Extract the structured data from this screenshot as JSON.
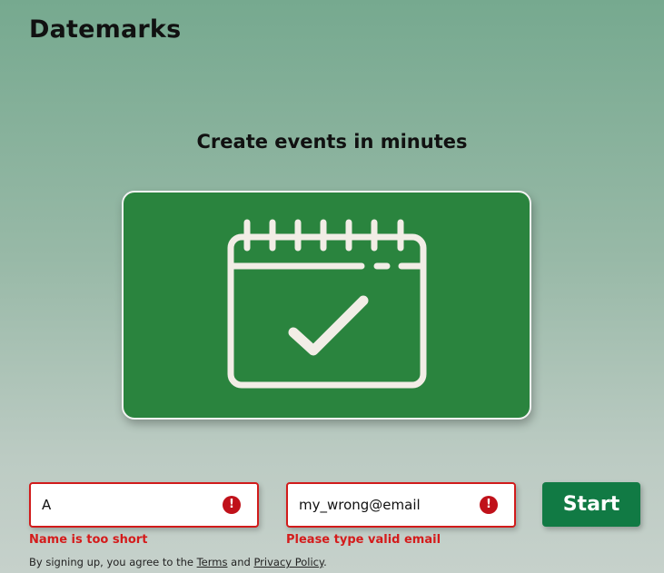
{
  "app": {
    "title": "Datemarks"
  },
  "hero": {
    "headline": "Create events in minutes",
    "card_color": "#2a843e",
    "icon": "calendar-check-icon"
  },
  "form": {
    "name": {
      "value": "A",
      "error": "Name is too short",
      "error_icon": "exclamation-icon"
    },
    "email": {
      "value": "my_wrong@email",
      "error": "Please type valid email",
      "error_icon": "exclamation-icon"
    },
    "start_label": "Start",
    "error_color": "#d11b1b",
    "button_color": "#117a44"
  },
  "legal": {
    "prefix": "By signing up, you agree to the",
    "terms": "Terms",
    "conjunction": "and",
    "privacy": "Privacy Policy",
    "suffix": "."
  }
}
